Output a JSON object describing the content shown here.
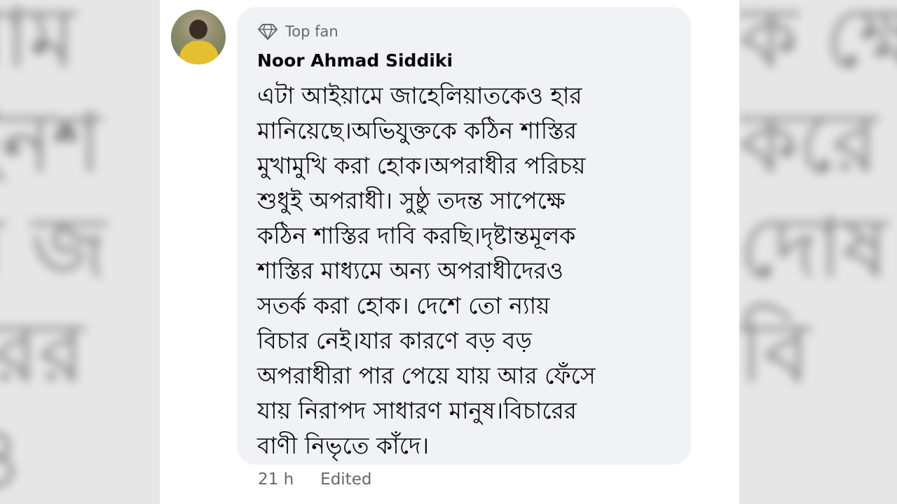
{
  "comment": {
    "badge_label": "Top fan",
    "badge_icon": "diamond-icon",
    "author": "Noor Ahmad Siddiki",
    "text": "এটা আইয়ামে জাহেলিয়াতকেও হার\nমানিয়েছে।অভিযুক্তকে কঠিন শাস্তির\nমুখামুখি করা হোক।অপরাধীর পরিচয়\nশুধুই অপরাধী। সুষ্ঠু তদন্ত সাপেক্ষে\nকঠিন শাস্তির দাবি করছি।দৃষ্টান্তমূলক\nশাস্তির মাধ্যমে অন্য অপরাধীদেরও\nসতর্ক করা হোক। দেশে তো ন্যায়\nবিচার নেই।যার কারণে বড় বড়\nঅপরাধীরা পার পেয়ে যায় আর ফেঁসে\nযায় নিরাপদ সাধারণ মানুষ।বিচারের\nবাণী নিভৃতে কাঁদে।",
    "timestamp": "21 h",
    "edited_label": "Edited"
  },
  "background": {
    "left_blur_text": "মাম\nইনশ\nর জ\nরের\nও",
    "right_blur_text": "ক ক্ষে\nকরে\nদোষ\nবি"
  }
}
